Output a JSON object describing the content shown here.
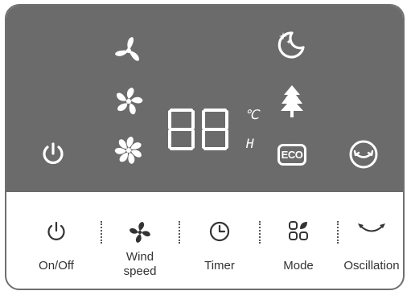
{
  "display": {
    "digits": "88",
    "unit_celsius": "℃",
    "unit_hour": "H",
    "eco_label": "ECO",
    "colors": {
      "background": "#6b6b6b",
      "icon": "#ffffff"
    }
  },
  "controls": [
    {
      "id": "onoff",
      "icon": "power-icon",
      "label": "On/Off"
    },
    {
      "id": "wind",
      "icon": "fan-icon",
      "label": "Wind\nspeed"
    },
    {
      "id": "timer",
      "icon": "clock-icon",
      "label": "Timer"
    },
    {
      "id": "mode",
      "icon": "mode-icon",
      "label": "Mode"
    },
    {
      "id": "oscillation",
      "icon": "oscillation-arrows-icon",
      "label": "Oscillation"
    }
  ]
}
